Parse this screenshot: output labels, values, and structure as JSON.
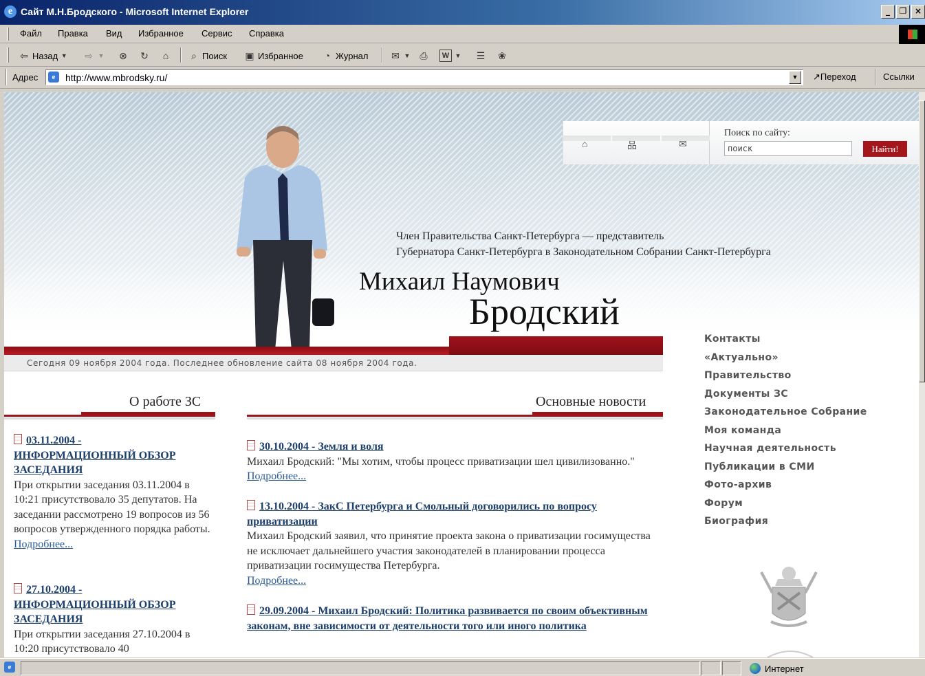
{
  "window": {
    "title": "Сайт М.Н.Бродского - Microsoft Internet Explorer"
  },
  "menu": [
    "Файл",
    "Правка",
    "Вид",
    "Избранное",
    "Сервис",
    "Справка"
  ],
  "toolbar": {
    "back": "Назад",
    "search": "Поиск",
    "favorites": "Избранное",
    "history": "Журнал"
  },
  "address": {
    "label": "Адрес",
    "url": "http://www.mbrodsky.ru/",
    "go": "Переход",
    "links": "Ссылки"
  },
  "status": {
    "zone": "Интернет"
  },
  "site": {
    "search": {
      "label": "Поиск по сайту:",
      "placeholder": "поиск",
      "button": "Найти!"
    },
    "subtitle_line1": "Член Правительства Санкт-Петербурга — представитель",
    "subtitle_line2": "Губернатора Санкт-Петербурга в Законодательном Собрании Санкт-Петербурга",
    "name_first": "Михаил Наумович",
    "name_last": "Бродский",
    "date_line": "Сегодня 09 ноября 2004 года. Последнее обновление сайта 08 ноября 2004 года.",
    "nav": [
      "Контакты",
      "«Актуально»",
      "Правительство",
      "Документы ЗС",
      "Законодательное Собрание",
      "Моя команда",
      "Научная деятельность",
      "Публикации в СМИ",
      "Фото-архив",
      "Форум",
      "Биография"
    ],
    "left_section": {
      "title": "О работе ЗС",
      "items": [
        {
          "head_date": "03.11.2004 -",
          "head_title": "ИНФОРМАЦИОННЫЙ ОБЗОР ЗАСЕДАНИЯ",
          "text": "При открытии заседания 03.11.2004 в 10:21 присутствовало 35 депутатов. На заседании рассмотрено 19 вопросов из 56 вопросов утвержденного порядка работы.",
          "more": "Подробнее..."
        },
        {
          "head_date": "27.10.2004 -",
          "head_title": "ИНФОРМАЦИОННЫЙ ОБЗОР ЗАСЕДАНИЯ",
          "text": "При открытии заседания 27.10.2004 в 10:20 присутствовало 40",
          "more": ""
        }
      ]
    },
    "main_section": {
      "title": "Основные новости",
      "items": [
        {
          "head": "30.10.2004 - Земля и воля",
          "text": "Михаил Бродский: \"Мы хотим, чтобы процесс приватизации шел цивилизованно.\"",
          "more": "Подробнее..."
        },
        {
          "head": "13.10.2004 - ЗакС Петербурга и Смольный договорились по вопросу приватизации",
          "text": "Михаил Бродский заявил, что принятие проекта закона о приватизации госимущества не исключает дальнейшего участия законодателей в планировании процесса приватизации госимущества Петербурга.",
          "more": "Подробнее..."
        },
        {
          "head": "29.09.2004 - Михаил Бродский: Политика развивается по своим объективным законам, вне зависимости от деятельности того или иного политика",
          "text": "",
          "more": ""
        }
      ]
    }
  }
}
